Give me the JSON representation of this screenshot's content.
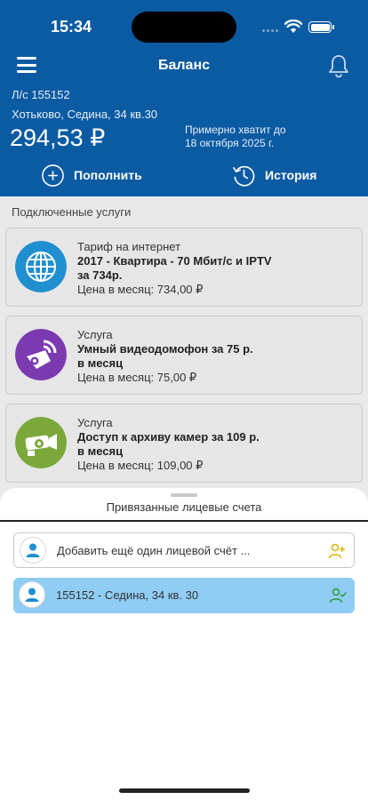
{
  "status_bar": {
    "time": "15:34"
  },
  "nav": {
    "title": "Баланс"
  },
  "account": {
    "number": "Л/с 155152",
    "address": "Хотьково, Седина, 34 кв.30",
    "balance": "294,53 ₽",
    "enough_line1": "Примерно хватит до",
    "enough_line2": "18 октября 2025 г."
  },
  "actions": {
    "topup": "Пополнить",
    "history": "История"
  },
  "services": {
    "label": "Подключенные услуги",
    "items": [
      {
        "kind": "Тариф на интернет",
        "name_line1": "2017 - Квартира - 70 Мбит/с и IPTV",
        "name_line2": "за 734р.",
        "price": "Цена в месяц: 734,00 ₽",
        "icon": "globe-icon"
      },
      {
        "kind": "Услуга",
        "name_line1": "Умный видеодомофон за 75 р.",
        "name_line2": "в месяц",
        "price": "Цена в месяц: 75,00 ₽",
        "icon": "intercom-icon"
      },
      {
        "kind": "Услуга",
        "name_line1": "Доступ к архиву камер за 109 р.",
        "name_line2": "в месяц",
        "price": "Цена в месяц: 109,00 ₽",
        "icon": "camera-archive-icon"
      }
    ]
  },
  "sheet": {
    "title": "Привязанные лицевые счета",
    "add_label": "Добавить ещё один лицевой счёт ...",
    "linked_account": "155152 - Седина, 34 кв. 30"
  },
  "colors": {
    "header": "#0b5ba3",
    "selected_row": "#8fcdf4",
    "globe": "#1f8fd0",
    "intercom": "#7b3ab0",
    "camera": "#7aa83a"
  }
}
